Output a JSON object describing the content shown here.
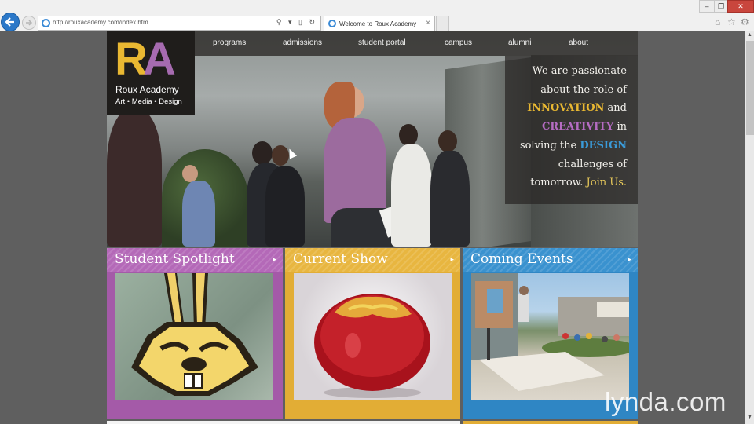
{
  "browser": {
    "url": "http://rouxacademy.com/index.htm",
    "tab_title": "Welcome to Roux Academy",
    "tab_close": "×",
    "addr_tools": "⚲ ▾ ▯ ↻",
    "min": "–",
    "max": "❐",
    "close": "✕",
    "icons": [
      "back-arrow-icon",
      "forward-arrow-icon",
      "home-icon",
      "favorites-star-icon",
      "settings-gear-icon"
    ]
  },
  "site": {
    "logo": {
      "letter_r": "R",
      "letter_a": "A",
      "name": "Roux Academy",
      "tagline": "Art • Media • Design"
    },
    "nav": [
      "programs",
      "admissions",
      "student portal",
      "campus",
      "alumni",
      "about"
    ],
    "hero": {
      "line1": "We are passionate",
      "line2": "about the role of",
      "word_innovation": "INNOVATION",
      "and": " and",
      "word_creativity": "CREATIVITY",
      "in": " in",
      "solving": "solving the ",
      "word_design": "DESIGN",
      "line6": "challenges of",
      "line7a": "tomorrow. ",
      "join": "Join Us."
    },
    "tiles": [
      {
        "title": "Student Spotlight",
        "arrow": "▸"
      },
      {
        "title": "Current Show",
        "arrow": "▸"
      },
      {
        "title": "Coming Events",
        "arrow": "▸"
      }
    ],
    "colors": {
      "yellow": "#e2ad35",
      "purple": "#a45aa8",
      "blue": "#2f86c4"
    }
  },
  "watermark": "lynda.com"
}
